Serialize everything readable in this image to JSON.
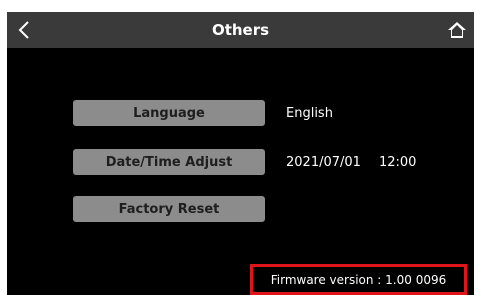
{
  "header": {
    "title": "Others",
    "back_icon": "chevron-left-icon",
    "home_icon": "home-icon"
  },
  "settings": {
    "language": {
      "button_label": "Language",
      "value": "English"
    },
    "datetime": {
      "button_label": "Date/Time Adjust",
      "date": "2021/07/01",
      "time": "12:00"
    },
    "factory_reset": {
      "button_label": "Factory Reset"
    }
  },
  "footer": {
    "firmware_text": "Firmware version : 1.00 0096",
    "highlight_color": "#e0141b"
  },
  "colors": {
    "header_bg": "#3a3a3a",
    "screen_bg": "#000000",
    "button_bg": "#8c8c8c",
    "text": "#ffffff"
  }
}
